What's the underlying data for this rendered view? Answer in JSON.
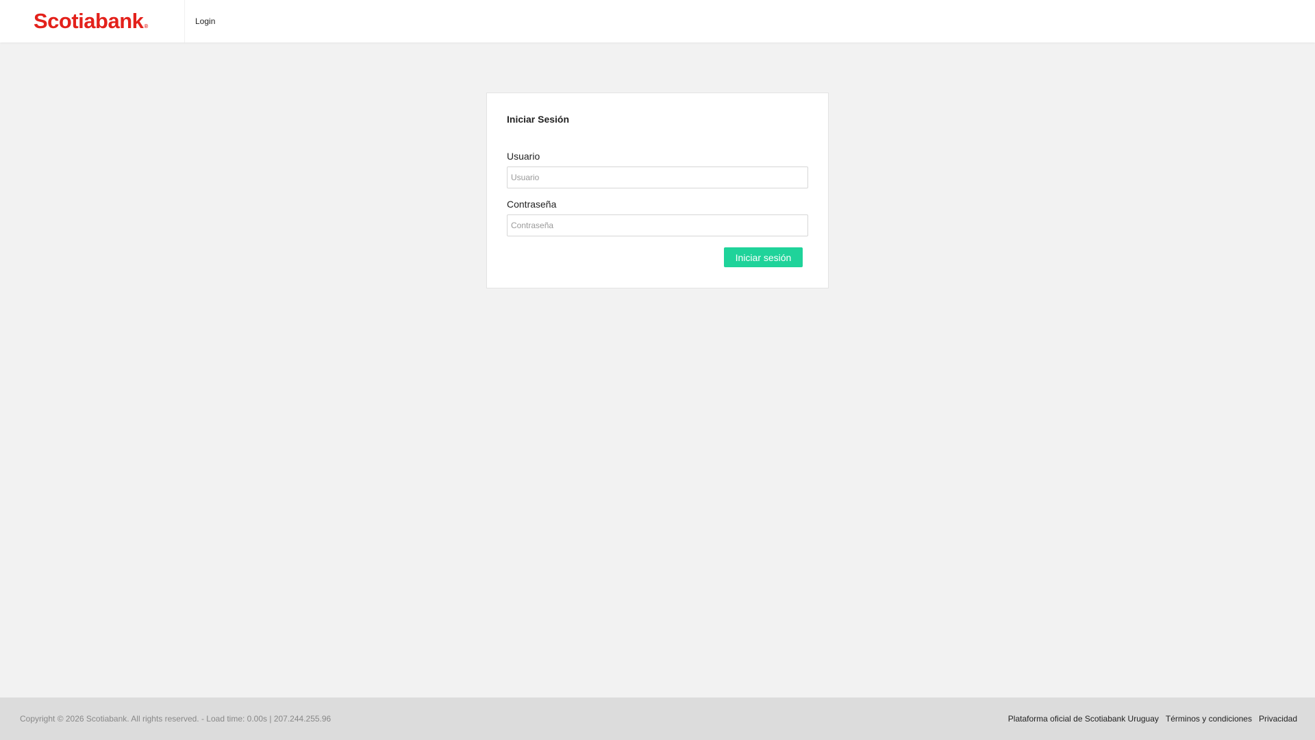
{
  "header": {
    "brand": "Scotiabank",
    "brand_mark": "®",
    "brand_color": "#e3211b",
    "nav_login": "Login"
  },
  "login_card": {
    "title": "Iniciar Sesión",
    "username_label": "Usuario",
    "username_placeholder": "Usuario",
    "username_value": "",
    "password_label": "Contraseña",
    "password_placeholder": "Contraseña",
    "password_value": "",
    "submit_label": "Iniciar sesión",
    "submit_color": "#1fd39a"
  },
  "footer": {
    "copyright": "Copyright © 2026 Scotiabank. All rights reserved. - Load time: 0.00s | 207.244.255.96",
    "links": [
      "Plataforma oficial de Scotiabank Uruguay",
      "Términos y condiciones",
      "Privacidad"
    ]
  }
}
